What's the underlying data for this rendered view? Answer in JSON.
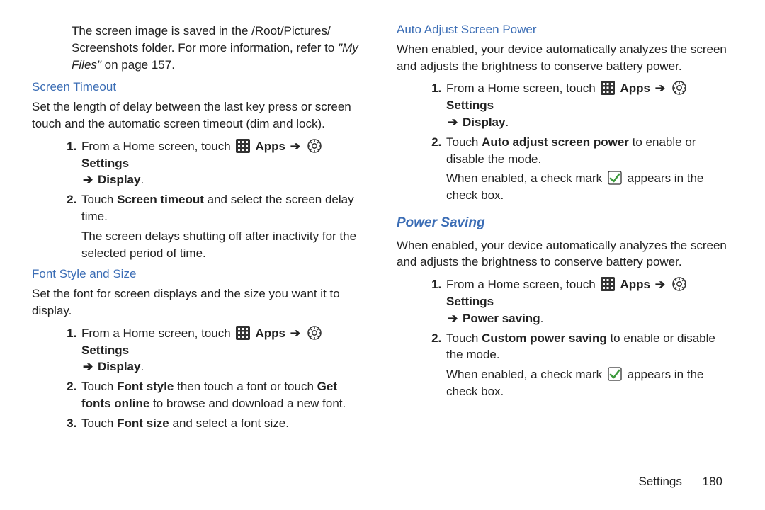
{
  "left": {
    "intro_pre": "The screen image is saved in the /Root/Pictures/ Screenshots folder. For more information, refer to ",
    "intro_ref": "\"My Files\"",
    "intro_post": "  on page 157.",
    "h1": "Screen Timeout",
    "h1_body": "Set the length of delay between the last key press or screen touch and the automatic screen timeout (dim and lock).",
    "h1_step1_pre": "From a Home screen, touch ",
    "apps": "Apps",
    "settings": "Settings",
    "display": "Display",
    "h1_step2_a": "Touch ",
    "h1_step2_b": "Screen timeout",
    "h1_step2_c": " and select the screen delay time.",
    "h1_step2_sub": "The screen delays shutting off after inactivity for the selected period of time.",
    "h2": "Font Style and Size",
    "h2_body": "Set the font for screen displays and the size you want it to display.",
    "h2_step1_pre": "From a Home screen, touch ",
    "h2_step2_a": "Touch ",
    "h2_step2_b": "Font style",
    "h2_step2_c": " then touch a font or touch ",
    "h2_step2_d": "Get fonts online",
    "h2_step2_e": " to browse and download a new font.",
    "h2_step3_a": "Touch ",
    "h2_step3_b": "Font size",
    "h2_step3_c": " and select a font size."
  },
  "right": {
    "h1": "Auto Adjust Screen Power",
    "h1_body": "When enabled, your device automatically analyzes the screen and adjusts the brightness to conserve battery power.",
    "step1_pre": "From a Home screen, touch ",
    "apps": "Apps",
    "settings": "Settings",
    "display": "Display",
    "h1_step2_a": "Touch ",
    "h1_step2_b": "Auto adjust screen power",
    "h1_step2_c": " to enable or disable the mode.",
    "check_pre": "When enabled, a check mark ",
    "check_post": " appears in the check box.",
    "h2": "Power Saving",
    "h2_body": "When enabled, your device automatically analyzes the screen and adjusts the brightness to conserve battery power.",
    "power_saving": "Power saving",
    "h2_step2_a": "Touch ",
    "h2_step2_b": "Custom power saving",
    "h2_step2_c": " to enable or disable the mode."
  },
  "footer": {
    "label": "Settings",
    "page": "180"
  },
  "arrow": "➔"
}
